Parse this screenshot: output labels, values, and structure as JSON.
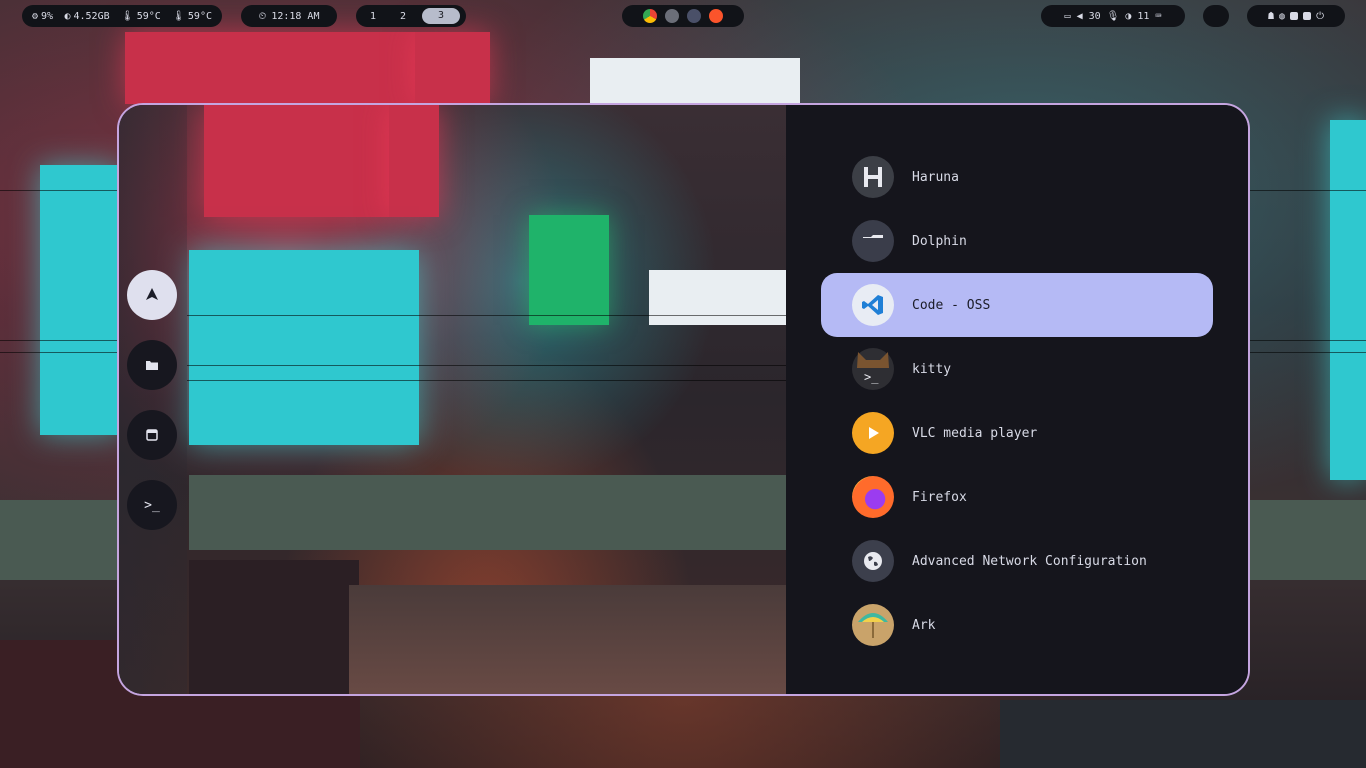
{
  "topbar": {
    "status": {
      "cpu": "9%",
      "ram": "4.52GB",
      "temp1": "59°C",
      "temp2": "59°C"
    },
    "clock": "12:18 AM",
    "workspaces": [
      "1",
      "2",
      "3"
    ],
    "active_workspace": "3",
    "apps": [
      "chrome-icon",
      "mouse-icon",
      "moon-icon",
      "brave-icon"
    ],
    "system": {
      "volume": "30",
      "mic": "11"
    }
  },
  "launcher": {
    "dock": [
      {
        "name": "arch-icon",
        "active": true
      },
      {
        "name": "folder-icon",
        "active": false
      },
      {
        "name": "window-icon",
        "active": false
      },
      {
        "name": "terminal-icon",
        "active": false
      }
    ],
    "apps": [
      {
        "label": "Haruna",
        "icon": "haruna-icon",
        "color": "#3c3f46"
      },
      {
        "label": "Dolphin",
        "icon": "dolphin-icon",
        "color": "#3a3d4a"
      },
      {
        "label": "Code - OSS",
        "icon": "vscode-icon",
        "color": "#e8ecf4",
        "selected": true
      },
      {
        "label": "kitty",
        "icon": "kitty-icon",
        "color": "#2e2e33"
      },
      {
        "label": "VLC media player",
        "icon": "vlc-icon",
        "color": "#f5a623"
      },
      {
        "label": "Firefox",
        "icon": "firefox-icon",
        "color": "#ff6b2b"
      },
      {
        "label": "Advanced Network Configuration",
        "icon": "network-icon",
        "color": "#3c3f4c"
      },
      {
        "label": "Ark",
        "icon": "ark-icon",
        "color": "#c9a36a"
      }
    ],
    "accent": "#b5baf5",
    "border": "#c5a5e0"
  }
}
